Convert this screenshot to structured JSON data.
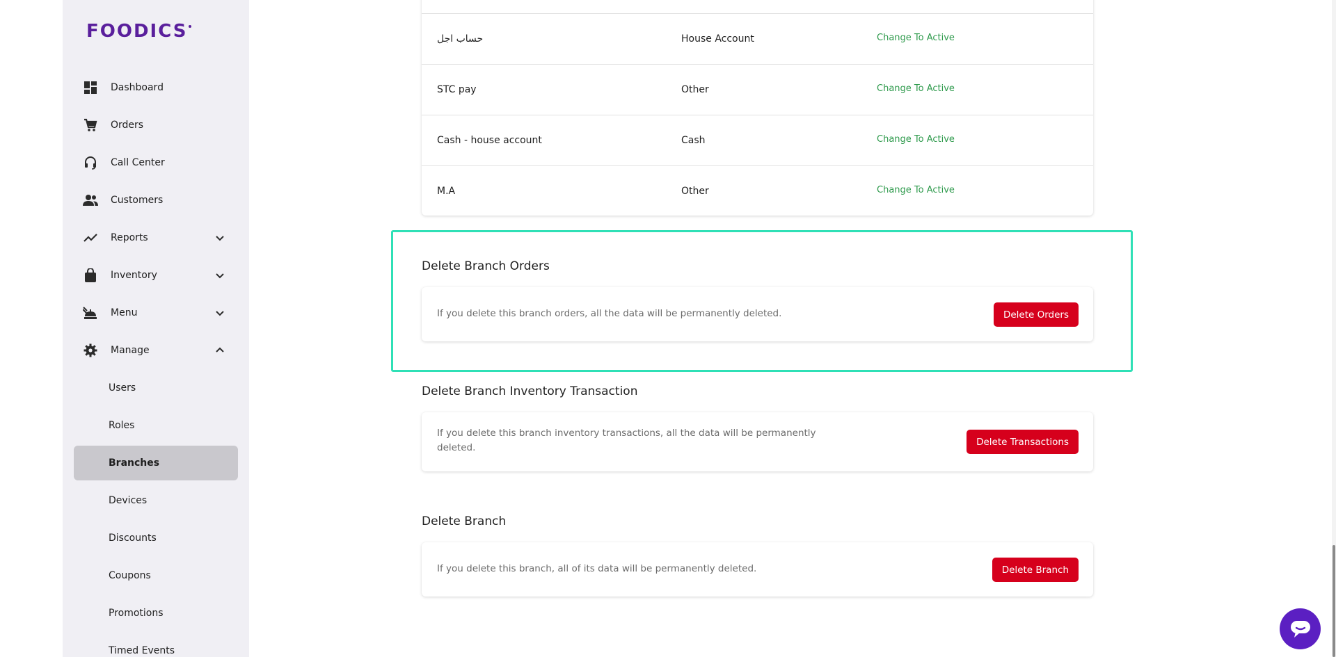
{
  "brand": {
    "logo_text": "FOODICS"
  },
  "sidebar": {
    "items": [
      {
        "label": "Dashboard",
        "icon": "dashboard-icon"
      },
      {
        "label": "Orders",
        "icon": "cart-icon"
      },
      {
        "label": "Call Center",
        "icon": "headset-icon"
      },
      {
        "label": "Customers",
        "icon": "people-icon"
      },
      {
        "label": "Reports",
        "icon": "trend-icon",
        "expandable": true,
        "expanded": false
      },
      {
        "label": "Inventory",
        "icon": "bag-icon",
        "expandable": true,
        "expanded": false
      },
      {
        "label": "Menu",
        "icon": "food-icon",
        "expandable": true,
        "expanded": false
      },
      {
        "label": "Manage",
        "icon": "gear-icon",
        "expandable": true,
        "expanded": true
      }
    ],
    "sub_items": [
      {
        "label": "Users"
      },
      {
        "label": "Roles"
      },
      {
        "label": "Branches",
        "active": true
      },
      {
        "label": "Devices"
      },
      {
        "label": "Discounts"
      },
      {
        "label": "Coupons"
      },
      {
        "label": "Promotions"
      },
      {
        "label": "Timed Events"
      }
    ]
  },
  "payment_methods_table": {
    "rows": [
      {
        "name": "حساب اجل",
        "type": "House Account",
        "action": "Change To Active"
      },
      {
        "name": "STC pay",
        "type": "Other",
        "action": "Change To Active"
      },
      {
        "name": "Cash - house account",
        "type": "Cash",
        "action": "Change To Active"
      },
      {
        "name": "M.A",
        "type": "Other",
        "action": "Change To Active"
      }
    ]
  },
  "delete_orders": {
    "title": "Delete Branch Orders",
    "text": "If you delete this branch orders, all the data will be permanently deleted.",
    "button": "Delete Orders"
  },
  "delete_inventory": {
    "title": "Delete Branch Inventory Transaction",
    "text_line1": "If you delete this branch inventory transactions, all the data will be permanently",
    "text_line2": "deleted.",
    "button": "Delete Transactions"
  },
  "delete_branch": {
    "title": "Delete Branch",
    "text": "If you delete this branch, all of its data will be permanently deleted.",
    "button": "Delete Branch"
  },
  "colors": {
    "brand": "#5a1f9c",
    "active_link": "#2e9a4c",
    "danger": "#d6001c",
    "highlight": "#2fe0b6",
    "chat": "#5b1fc2"
  }
}
